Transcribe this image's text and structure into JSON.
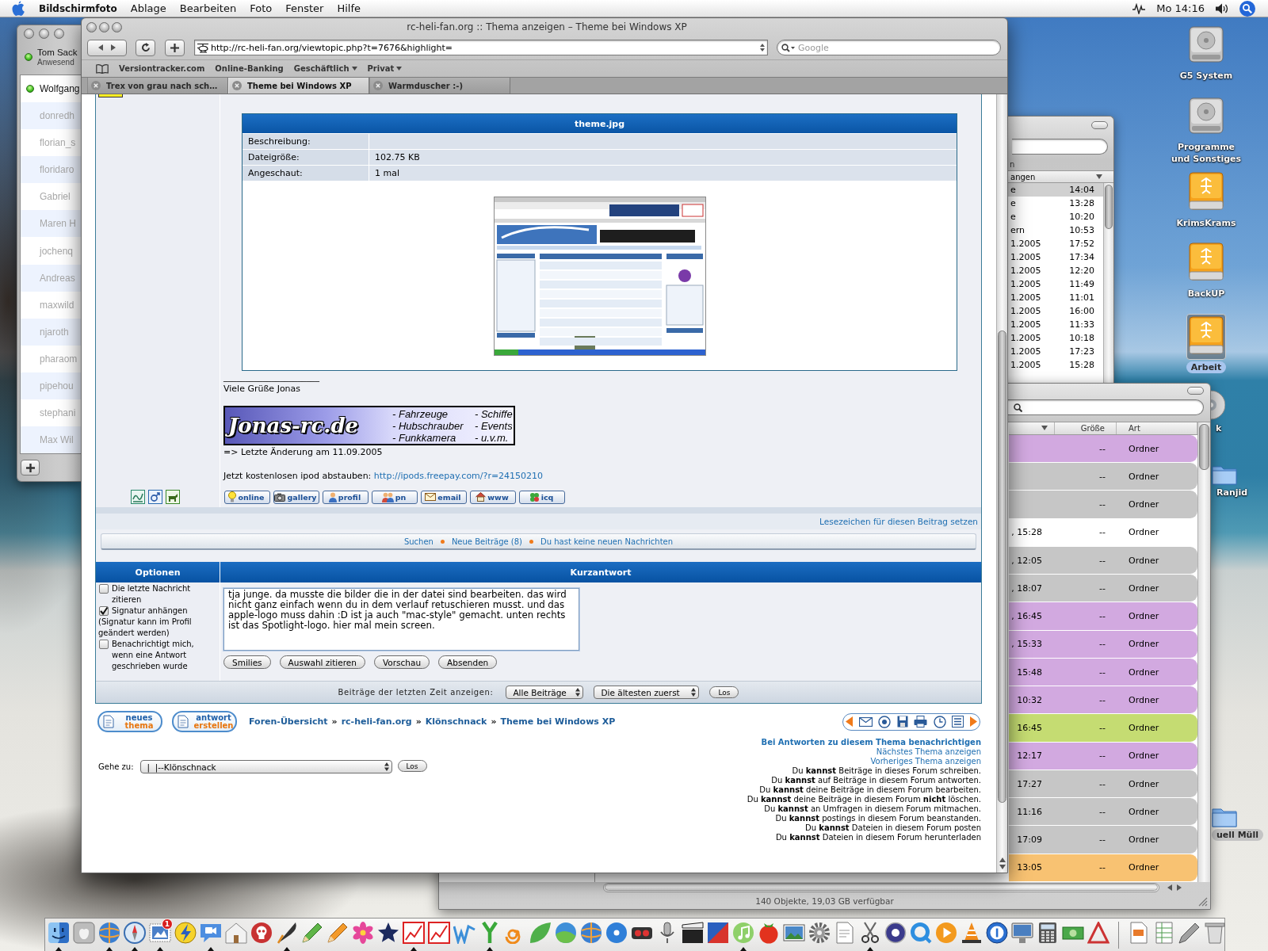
{
  "menu_bar": {
    "app_name": "Bildschirmfoto",
    "menus": [
      "Ablage",
      "Bearbeiten",
      "Foto",
      "Fenster",
      "Hilfe"
    ],
    "clock": "Mo 14:16"
  },
  "buddy_list": {
    "account": {
      "name": "Tom Sack",
      "status": "Anwesend",
      "online": true
    },
    "buddies": [
      {
        "name": "Wolfgang",
        "online": true
      },
      {
        "name": "donredh",
        "online": false
      },
      {
        "name": "florian_s",
        "online": false
      },
      {
        "name": "floridaro",
        "online": false
      },
      {
        "name": "Gabriel",
        "online": false
      },
      {
        "name": "Maren H",
        "online": false
      },
      {
        "name": "jochenq",
        "online": false
      },
      {
        "name": "Andreas",
        "online": false
      },
      {
        "name": "maxwild",
        "online": false
      },
      {
        "name": "njaroth",
        "online": false
      },
      {
        "name": "pharaom",
        "online": false
      },
      {
        "name": "pipehou",
        "online": false
      },
      {
        "name": "stephani",
        "online": false
      },
      {
        "name": "Max Wil",
        "online": false
      }
    ]
  },
  "browser": {
    "title": "rc-heli-fan.org :: Thema anzeigen – Theme bei Windows XP",
    "url": "http://rc-heli-fan.org/viewtopic.php?t=7676&highlight=",
    "search_placeholder": "Google",
    "bookmarks": [
      {
        "label": "Versiontracker.com",
        "menu": false
      },
      {
        "label": "Online-Banking",
        "menu": false
      },
      {
        "label": "Geschäftlich",
        "menu": true
      },
      {
        "label": "Privat",
        "menu": true
      }
    ],
    "tabs": [
      {
        "label": "Trex von grau nach sch…",
        "selected": false
      },
      {
        "label": "Theme bei Windows XP",
        "selected": true
      },
      {
        "label": "Warmduscher :-)",
        "selected": false
      }
    ]
  },
  "forum": {
    "attachment": {
      "title": "theme.jpg",
      "rows": [
        {
          "label": "Beschreibung:"
        },
        {
          "label": "Dateigröße:",
          "value": "102.75 KB"
        },
        {
          "label": "Angeschaut:",
          "value": "1 mal"
        }
      ]
    },
    "signature": {
      "rule": "______________________",
      "greeting": "Viele Grüße Jonas",
      "banner": {
        "logo": "Jonas-rc.de",
        "items": [
          "- Fahrzeuge",
          "- Schiffe",
          "- Hubschrauber",
          "- Events",
          "- Funkkamera",
          "- u.v.m."
        ]
      },
      "update_note": "=> Letzte Änderung am 11.09.2005",
      "promo": {
        "text": "Jetzt kostenlosen ipod abstauben:",
        "link": "http://ipods.freepay.com/?r=24150210"
      }
    },
    "profile_buttons": [
      {
        "label": "online",
        "kind": "bulb"
      },
      {
        "label": "gallery",
        "kind": "camera"
      },
      {
        "label": "profil",
        "kind": "person"
      },
      {
        "label": "pn",
        "kind": "people"
      },
      {
        "label": "email",
        "kind": "envelope"
      },
      {
        "label": "www",
        "kind": "house"
      },
      {
        "label": "icq",
        "kind": "clover"
      }
    ],
    "bookmark_link": "Lesezeichen für diesen Beitrag setzen",
    "nav_links": [
      "Suchen",
      "Neue Beiträge (8)",
      "Du hast keine neuen Nachrichten"
    ],
    "quick_reply": {
      "options_heading": "Optionen",
      "reply_heading": "Kurzantwort",
      "options": [
        {
          "label": "Die letzte Nachricht zitieren",
          "checked": false
        },
        {
          "label": "Signatur anhängen",
          "checked": true,
          "note": "(Signatur kann im Profil geändert werden)"
        },
        {
          "label": "Benachrichtigt mich, wenn eine Antwort geschrieben wurde",
          "checked": false
        }
      ],
      "message": "tja junge. da musste die bilder die in der datei sind bearbeiten. das wird nicht ganz einfach wenn du in dem verlauf retuschieren musst. und das apple-logo muss dahin :D ist ja auch \"mac-style\" gemacht. unten rechts ist das Spotlight-logo. hier mal mein screen.",
      "buttons": [
        "Smilies",
        "Auswahl zitieren",
        "Vorschau",
        "Absenden"
      ]
    },
    "display_filter": {
      "label": "Beiträge der letzten Zeit anzeigen:",
      "selects": [
        "Alle Beiträge",
        "Die ältesten zuerst"
      ],
      "button": "Los"
    },
    "topic_buttons": [
      {
        "top": "neues",
        "bottom": "thema"
      },
      {
        "top": "antwort",
        "bottom": "erstellen"
      }
    ],
    "breadcrumbs": {
      "separator": "»",
      "items": [
        "Foren-Übersicht",
        "rc-heli-fan.org",
        "Klönschnack",
        "Theme bei Windows XP"
      ]
    },
    "topic_links": [
      {
        "label": "Bei Antworten zu diesem Thema benachrichtigen",
        "emphasized": true
      },
      {
        "label": "Nächstes Thema anzeigen",
        "emphasized": false
      },
      {
        "label": "Vorheriges Thema anzeigen",
        "emphasized": false
      }
    ],
    "permissions": [
      "Du **kannst** Beiträge in dieses Forum schreiben.",
      "Du **kannst** auf Beiträge in diesem Forum antworten.",
      "Du **kannst** deine Beiträge in diesem Forum bearbeiten.",
      "Du **kannst** deine Beiträge in diesem Forum **nicht** löschen.",
      "Du **kannst** an Umfragen in diesem Forum mitmachen.",
      "Du **kannst** postings in diesem Forum beanstanden.",
      "Du **kannst** Dateien in diesem Forum posten",
      "Du **kannst** Dateien in diesem Forum herunterladen"
    ],
    "jump_box": {
      "label": "Gehe zu:",
      "value": "|  |--Klönschnack",
      "button": "Los"
    }
  },
  "finder_back": {
    "path_text": "n",
    "column": "angen",
    "rows": [
      {
        "name": "e",
        "time": "14:04",
        "selected": true
      },
      {
        "name": "e",
        "time": "13:28",
        "selected": false
      },
      {
        "name": "e",
        "time": "10:20",
        "selected": false
      },
      {
        "name": "ern",
        "time": "10:53",
        "selected": false
      },
      {
        "name": "1.2005",
        "time": "17:52",
        "selected": false
      },
      {
        "name": "1.2005",
        "time": "17:34",
        "selected": false
      },
      {
        "name": "1.2005",
        "time": "12:20",
        "selected": false
      },
      {
        "name": "1.2005",
        "time": "11:49",
        "selected": false
      },
      {
        "name": "1.2005",
        "time": "11:01",
        "selected": false
      },
      {
        "name": "1.2005",
        "time": "16:00",
        "selected": false
      },
      {
        "name": "1.2005",
        "time": "11:33",
        "selected": false
      },
      {
        "name": "1.2005",
        "time": "10:18",
        "selected": false
      },
      {
        "name": "1.2005",
        "time": "17:23",
        "selected": false
      },
      {
        "name": "1.2005",
        "time": "15:28",
        "selected": false
      }
    ]
  },
  "finder_front": {
    "columns": [
      "Größe",
      "Art"
    ],
    "rows": [
      {
        "size": "--",
        "type": "Ordner",
        "color": "#d2a9e0"
      },
      {
        "size": "--",
        "type": "Ordner",
        "color": "#c6c6c6"
      },
      {
        "size": "--",
        "type": "Ordner",
        "color": "#c6c6c6"
      },
      {
        "date": ", 15:28",
        "size": "--",
        "type": "Ordner",
        "color": "#ffffff"
      },
      {
        "date": ", 12:05",
        "size": "--",
        "type": "Ordner",
        "color": "#c6c6c6"
      },
      {
        "date": ", 18:07",
        "size": "--",
        "type": "Ordner",
        "color": "#c6c6c6"
      },
      {
        "date": ", 16:45",
        "size": "--",
        "type": "Ordner",
        "color": "#d2a9e0"
      },
      {
        "date": ", 15:33",
        "size": "--",
        "type": "Ordner",
        "color": "#d2a9e0"
      },
      {
        "date": "15:48",
        "size": "--",
        "type": "Ordner",
        "color": "#d2a9e0"
      },
      {
        "date": "10:32",
        "size": "--",
        "type": "Ordner",
        "color": "#d2a9e0"
      },
      {
        "date": "16:45",
        "size": "--",
        "type": "Ordner",
        "color": "#c5dc72"
      },
      {
        "date": "12:17",
        "size": "--",
        "type": "Ordner",
        "color": "#d2a9e0"
      },
      {
        "date": "17:27",
        "size": "--",
        "type": "Ordner",
        "color": "#c6c6c6"
      },
      {
        "date": "11:16",
        "size": "--",
        "type": "Ordner",
        "color": "#c6c6c6"
      },
      {
        "date": "17:09",
        "size": "--",
        "type": "Ordner",
        "color": "#c6c6c6"
      },
      {
        "date": "13:05",
        "size": "--",
        "type": "Ordner",
        "color": "#f8c272"
      }
    ],
    "status": "140 Objekte, 19,03 GB verfügbar"
  },
  "desktop_icons": [
    {
      "label": "G5 System",
      "kind": "drive",
      "selected": false
    },
    {
      "label": "Programme und Sonstiges",
      "kind": "drive",
      "selected": false
    },
    {
      "label": "KrimsKrams",
      "kind": "firewire",
      "selected": false
    },
    {
      "label": "BackUP",
      "kind": "firewire",
      "selected": false
    },
    {
      "label": "Arbeit",
      "kind": "firewire",
      "selected": true
    },
    {
      "label": "k",
      "kind": "disc",
      "selected": false
    },
    {
      "label": "Ranjid",
      "kind": "folder",
      "selected": false
    },
    {
      "label": "uell Müll",
      "kind": "folder",
      "selected": false,
      "color": "#c4c4c4"
    }
  ],
  "dock": {
    "items": [
      {
        "kind": "finder",
        "running": true
      },
      {
        "kind": "apple",
        "running": false
      },
      {
        "kind": "globe",
        "running": true
      },
      {
        "kind": "compass",
        "running": true
      },
      {
        "kind": "stamp",
        "running": true,
        "badge": "1"
      },
      {
        "kind": "bolt",
        "running": false
      },
      {
        "kind": "bubble",
        "running": true
      },
      {
        "kind": "house",
        "running": false
      },
      {
        "kind": "skull",
        "running": false
      },
      {
        "kind": "quill",
        "running": true
      },
      {
        "kind": "pencil",
        "running": false
      },
      {
        "kind": "crayon",
        "running": false
      },
      {
        "kind": "flower",
        "running": false
      },
      {
        "kind": "star",
        "running": false
      },
      {
        "kind": "chart",
        "running": true
      },
      {
        "kind": "chart",
        "running": false
      },
      {
        "kind": "wave",
        "running": false
      },
      {
        "kind": "fork",
        "running": true
      },
      {
        "kind": "swirl",
        "running": false
      },
      {
        "kind": "leaf",
        "running": false
      },
      {
        "kind": "marble",
        "running": false
      },
      {
        "kind": "globe",
        "running": false
      },
      {
        "kind": "disc",
        "running": false
      },
      {
        "kind": "tool",
        "running": false
      },
      {
        "kind": "mic",
        "running": false
      },
      {
        "kind": "clapper",
        "running": false
      },
      {
        "kind": "book",
        "running": false
      },
      {
        "kind": "note",
        "running": true
      },
      {
        "kind": "tomato",
        "running": false
      },
      {
        "kind": "photo",
        "running": false
      },
      {
        "kind": "gear",
        "running": false
      },
      {
        "kind": "paper",
        "running": false
      },
      {
        "kind": "scissors",
        "running": true
      },
      {
        "kind": "seal",
        "running": false
      },
      {
        "kind": "ring",
        "running": false
      },
      {
        "kind": "play",
        "running": false
      },
      {
        "kind": "cone",
        "running": false
      },
      {
        "kind": "dial",
        "running": false
      },
      {
        "kind": "monitor",
        "running": false
      },
      {
        "kind": "calc",
        "running": false
      },
      {
        "kind": "cash",
        "running": false
      },
      {
        "kind": "triangle",
        "running": false
      },
      {
        "kind": "separator"
      },
      {
        "kind": "pages",
        "running": false
      },
      {
        "kind": "sheet",
        "running": false
      },
      {
        "kind": "pen",
        "running": false
      },
      {
        "kind": "trash",
        "running": false
      }
    ]
  }
}
